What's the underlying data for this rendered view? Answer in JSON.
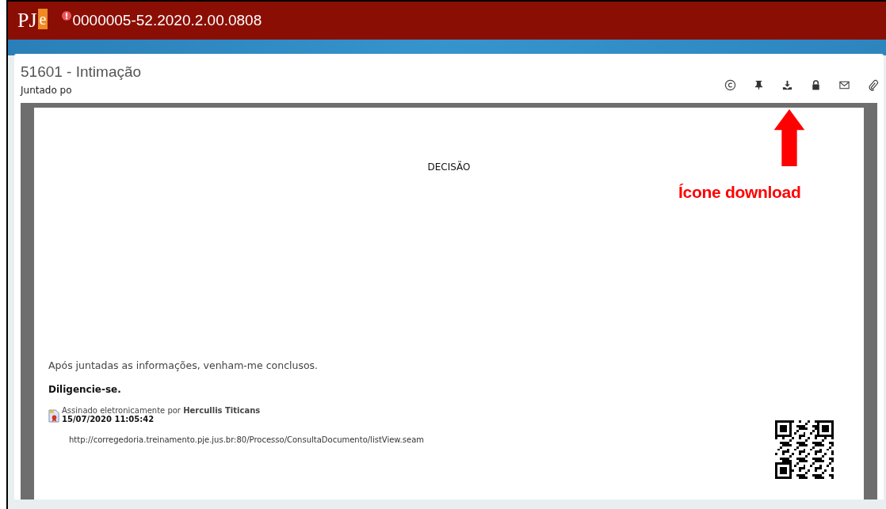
{
  "header": {
    "logo": {
      "main": "PJ",
      "accent": "e"
    },
    "alert": true,
    "process_number": "0000005-52.2020.2.00.0808"
  },
  "document": {
    "title": "51601 - Intimação",
    "subtitle": "Juntado po",
    "heading": "DECISÃO",
    "paragraphs": [
      {
        "text": "Após juntadas as informações, venham-me conclusos.",
        "bold": false
      },
      {
        "text": "Diligencie-se.",
        "bold": true
      }
    ],
    "signature": {
      "text": "Assinado eletronicamente por **Hercullis Titicans**",
      "date": "15/07/2020 11:05:42"
    },
    "url": "http://corregedoria.treinamento.pje.jus.br:80/Processo/ConsultaDocumento/listView.seam"
  },
  "annotation": {
    "label": "Ícone download"
  }
}
